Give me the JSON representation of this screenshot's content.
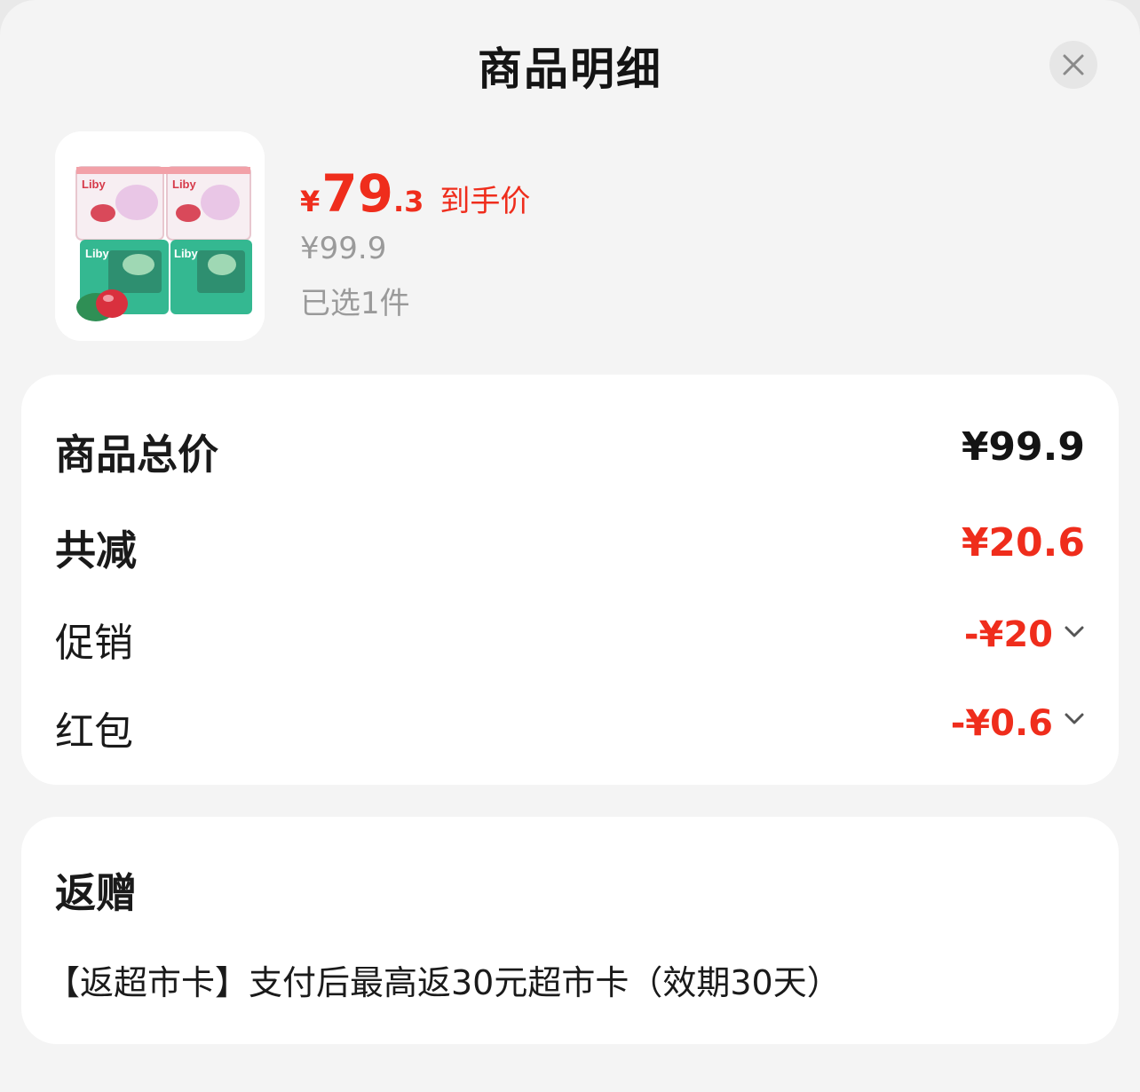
{
  "header": {
    "title": "商品明细"
  },
  "close_icon": "close-icon",
  "product": {
    "image_icon": "product-image",
    "brand_text": "Liby",
    "price_symbol": "¥",
    "price_int": "79",
    "price_dec": ".3",
    "price_tag": "到手价",
    "original_price": "¥99.9",
    "selected_text": "已选1件"
  },
  "summary": {
    "total_label": "商品总价",
    "total_value": "¥99.9",
    "discount_label": "共减",
    "discount_value": "¥20.6",
    "promo_label": "促销",
    "promo_value": "-¥20",
    "redpacket_label": "红包",
    "redpacket_value": "-¥0.6"
  },
  "gift": {
    "title": "返赠",
    "description": "【返超市卡】支付后最高返30元超市卡（效期30天）"
  },
  "colors": {
    "accent_red": "#ef2d1c",
    "muted_gray": "#9a9a9a",
    "background": "#f4f4f4"
  }
}
